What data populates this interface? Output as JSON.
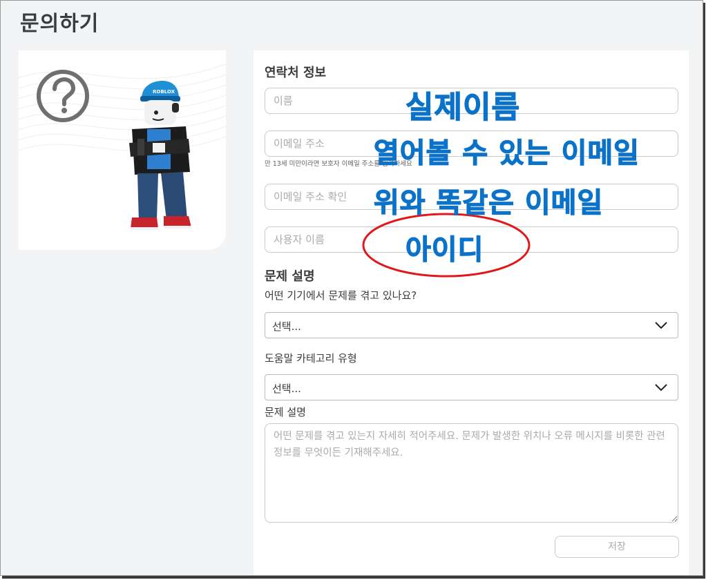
{
  "page": {
    "title": "문의하기"
  },
  "contact_section": {
    "title": "연락처 정보",
    "name_placeholder": "이름",
    "email_placeholder": "이메일 주소",
    "email_helper": "만 13세 미만이라면 보호자 이메일 주소를 입력하세요",
    "email_confirm_placeholder": "이메일 주소 확인",
    "username_placeholder": "사용자 이름"
  },
  "problem_section": {
    "title": "문제 설명",
    "device_label": "어떤 기기에서 문제를 겪고 있나요?",
    "device_value": "선택...",
    "category_label": "도움말 카테고리 유형",
    "category_value": "선택...",
    "description_label": "문제 설명",
    "description_placeholder": "어떤 문제를 겪고 있는지 자세히 적어주세요. 문제가 발생한 위치나 오류 메시지를 비롯한 관련 정보를 무엇이든 기재해주세요.",
    "save_label": "저장"
  },
  "annotations": {
    "real_name": "실제이름",
    "openable_email": "열어볼 수 있는 이메일",
    "same_email": "위와 똑같은 이메일",
    "user_id": "아이디",
    "text_color": "#0a72c9",
    "circle_color": "#e0181c"
  },
  "side_card": {
    "icon": "question-circle-icon",
    "image": "roblox-avatar",
    "cap_text": "ROBLOX"
  }
}
